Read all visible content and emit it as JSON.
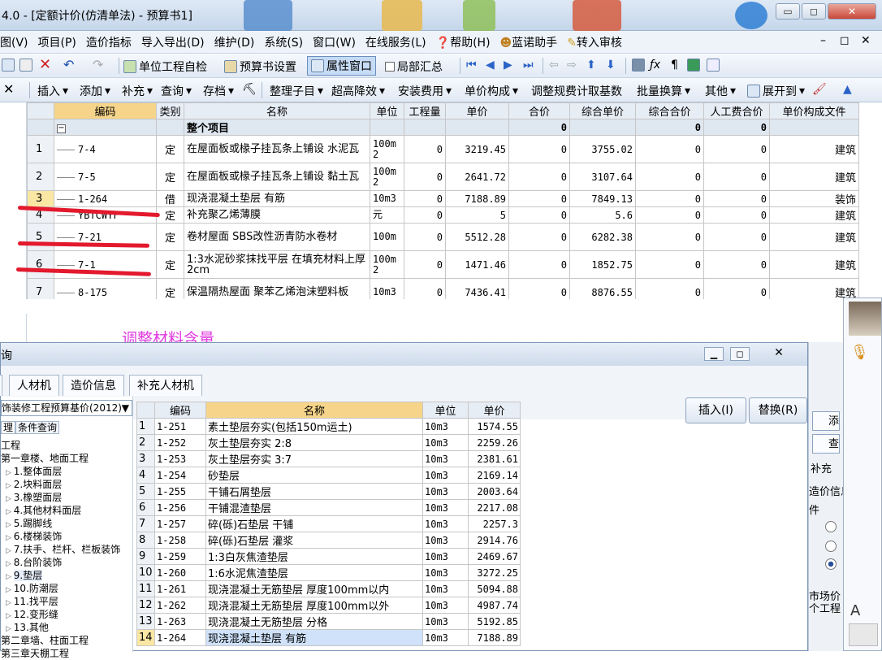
{
  "window": {
    "title": "4.0 - [定额计价(仿清单法) - 预算书1]",
    "min": "▭",
    "restore": "◻",
    "close": "✕"
  },
  "menu": [
    "图(V)",
    "项目(P)",
    "造价指标",
    "导入导出(D)",
    "维护(D)",
    "系统(S)",
    "窗口(W)",
    "在线服务(L)",
    "帮助(H)",
    "蓝诺助手",
    "转入审核"
  ],
  "menu_right": [
    "–",
    "◻",
    "✕"
  ],
  "toolbar1": {
    "self_check": "单位工程自检",
    "settings": "预算书设置",
    "property_window": "属性窗口",
    "partial_summary": "局部汇总"
  },
  "toolbar2": {
    "insert": "插入",
    "add": "添加",
    "supplement": "补充",
    "query": "查询",
    "save": "存档",
    "organize": "整理子目",
    "super_high": "超高降效",
    "install_fee": "安装费用",
    "unit_compose": "单价构成",
    "adjust_fee": "调整规费计取基数",
    "batch_replace": "批量换算",
    "other": "其他",
    "expand": "展开到"
  },
  "main_table": {
    "headers": [
      "编码",
      "类别",
      "名称",
      "单位",
      "工程量",
      "单价",
      "合价",
      "综合单价",
      "综合合价",
      "人工费合价",
      "单价构成文件"
    ],
    "summary": {
      "name": "整个项目",
      "total": "0",
      "comp_total": "0",
      "labor": "0"
    },
    "rows": [
      {
        "no": "1",
        "code": "7-4",
        "type": "定",
        "name": "在屋面板或椽子挂瓦条上铺设 水泥瓦",
        "unit": "100m2",
        "qty": "0",
        "price": "3219.45",
        "total": "0",
        "comp_price": "3755.02",
        "comp_total": "0",
        "labor": "0",
        "file": "建筑"
      },
      {
        "no": "2",
        "code": "7-5",
        "type": "定",
        "name": "在屋面板或椽子挂瓦条上铺设 黏土瓦",
        "unit": "100m2",
        "qty": "0",
        "price": "2641.72",
        "total": "0",
        "comp_price": "3107.64",
        "comp_total": "0",
        "labor": "0",
        "file": "建筑"
      },
      {
        "no": "3",
        "code": "1-264",
        "type": "借",
        "name": "现浇混凝土垫层 有筋",
        "unit": "10m3",
        "qty": "0",
        "price": "7188.89",
        "total": "0",
        "comp_price": "7849.13",
        "comp_total": "0",
        "labor": "0",
        "file": "装饰"
      },
      {
        "no": "4",
        "code": "YBTCWYF",
        "type": "定",
        "name": "补充聚乙烯薄膜",
        "unit": "元",
        "qty": "0",
        "price": "5",
        "total": "0",
        "comp_price": "5.6",
        "comp_total": "0",
        "labor": "0",
        "file": "建筑"
      },
      {
        "no": "5",
        "code": "7-21",
        "type": "定",
        "name": "卷材屋面 SBS改性沥青防水卷材",
        "unit": "100m",
        "qty": "0",
        "price": "5512.28",
        "total": "0",
        "comp_price": "6282.38",
        "comp_total": "0",
        "labor": "0",
        "file": "建筑"
      },
      {
        "no": "6",
        "code": "7-1",
        "type": "定",
        "name": "1:3水泥砂浆抹找平层 在填充材料上厚2cm",
        "unit": "100m2",
        "qty": "0",
        "price": "1471.46",
        "total": "0",
        "comp_price": "1852.75",
        "comp_total": "0",
        "labor": "0",
        "file": "建筑"
      },
      {
        "no": "7",
        "code": "8-175",
        "type": "定",
        "name": "保温隔热屋面 聚苯乙烯泡沫塑料板",
        "unit": "10m3",
        "qty": "0",
        "price": "7436.41",
        "total": "0",
        "comp_price": "8876.55",
        "comp_total": "0",
        "labor": "0",
        "file": "建筑"
      }
    ]
  },
  "annotation": "调整材料含量",
  "dialog": {
    "title_char": "询",
    "tabs": [
      "人材机",
      "造价信息",
      "补充人材机"
    ],
    "insert_button": "插入(I)",
    "replace_button": "替换(R)",
    "library": "饰装修工程预算基价(2012)",
    "search_tabs": [
      "理",
      "条件查询"
    ],
    "tree": [
      "工程",
      "第一章楼、地面工程",
      "1.整体面层",
      "2.块料面层",
      "3.橡塑面层",
      "4.其他材料面层",
      "5.踢脚线",
      "6.楼梯装饰",
      "7.扶手、栏杆、栏板装饰",
      "8.台阶装饰",
      "9.垫层",
      "10.防潮层",
      "11.找平层",
      "12.变形缝",
      "13.其他",
      "第二章墙、柱面工程",
      "第三章天棚工程"
    ],
    "headers": [
      "编码",
      "名称",
      "单位",
      "单价"
    ],
    "rows": [
      {
        "no": "1",
        "code": "1-251",
        "name": "素土垫层夯实(包括150m运土)",
        "unit": "10m3",
        "price": "1574.55"
      },
      {
        "no": "2",
        "code": "1-252",
        "name": "灰土垫层夯实 2:8",
        "unit": "10m3",
        "price": "2259.26"
      },
      {
        "no": "3",
        "code": "1-253",
        "name": "灰土垫层夯实 3:7",
        "unit": "10m3",
        "price": "2381.61"
      },
      {
        "no": "4",
        "code": "1-254",
        "name": "砂垫层",
        "unit": "10m3",
        "price": "2169.14"
      },
      {
        "no": "5",
        "code": "1-255",
        "name": "干铺石屑垫层",
        "unit": "10m3",
        "price": "2003.64"
      },
      {
        "no": "6",
        "code": "1-256",
        "name": "干铺混渣垫层",
        "unit": "10m3",
        "price": "2217.08"
      },
      {
        "no": "7",
        "code": "1-257",
        "name": "碎(砾)石垫层 干铺",
        "unit": "10m3",
        "price": "2257.3"
      },
      {
        "no": "8",
        "code": "1-258",
        "name": "碎(砾)石垫层 灌浆",
        "unit": "10m3",
        "price": "2914.76"
      },
      {
        "no": "9",
        "code": "1-259",
        "name": "1:3白灰焦渣垫层",
        "unit": "10m3",
        "price": "2469.67"
      },
      {
        "no": "10",
        "code": "1-260",
        "name": "1:6水泥焦渣垫层",
        "unit": "10m3",
        "price": "3272.25"
      },
      {
        "no": "11",
        "code": "1-261",
        "name": "现浇混凝土无筋垫层 厚度100mm以内",
        "unit": "10m3",
        "price": "5094.88"
      },
      {
        "no": "12",
        "code": "1-262",
        "name": "现浇混凝土无筋垫层 厚度100mm以外",
        "unit": "10m3",
        "price": "4987.74"
      },
      {
        "no": "13",
        "code": "1-263",
        "name": "现浇混凝土无筋垫层 分格",
        "unit": "10m3",
        "price": "5192.85"
      },
      {
        "no": "14",
        "code": "1-264",
        "name": "现浇混凝土垫层 有筋",
        "unit": "10m3",
        "price": "7188.89"
      }
    ]
  },
  "right_panel": [
    "添",
    "查",
    "补充",
    "造价信息",
    "件",
    "市场价",
    "个工程"
  ],
  "ime": {
    "letter": "A"
  }
}
